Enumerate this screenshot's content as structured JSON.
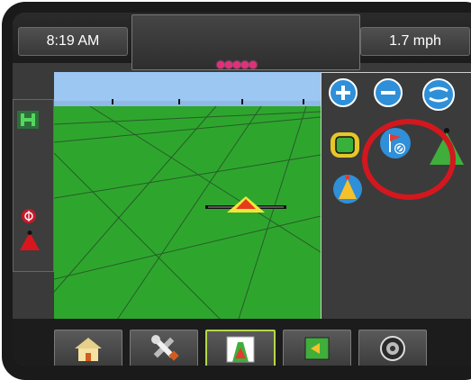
{
  "topbar": {
    "time": "8:19 AM",
    "speed": "1.7 mph",
    "status_leds": 5,
    "led_color": "#e0307a"
  },
  "left_rail": {
    "items": [
      "h-mode-icon",
      "red-warning-icon",
      "red-vehicle-triangle-icon"
    ]
  },
  "right_panel": {
    "controls": [
      "zoom-in-icon",
      "zoom-out-icon",
      "route-switch-icon",
      "boundary-map-icon",
      "flag-no-icon",
      "green-perspective-icon",
      "guidance-triangle-icon"
    ]
  },
  "bottom_tabs": [
    "home-icon",
    "tools-icon",
    "guidance-view-icon",
    "field-map-icon",
    "camera-icon"
  ],
  "colors": {
    "sky": "#9cc7f2",
    "ground": "#2ea62e",
    "accent": "#b4d84a",
    "highlight_ring": "#d3171f"
  }
}
